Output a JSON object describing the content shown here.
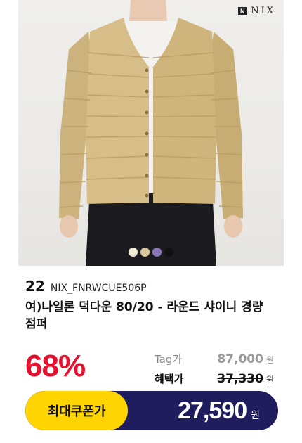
{
  "brand": {
    "logo_text": "NIX"
  },
  "colors": {
    "accent_red": "#e8102f",
    "coupon_yellow": "#ffd400",
    "coupon_navy": "#1f1d5e"
  },
  "swatches": [
    "#f0ead6",
    "#d8c79a",
    "#8a77b8",
    "#111111"
  ],
  "product": {
    "rank": "22",
    "code": "NIX_FNRWCUE506P",
    "title": "여)나일론 덕다운 80/20 - 라운드 샤이니 경량 점퍼",
    "discount": "68%",
    "tag_label": "Tag가",
    "tag_price": "87,000",
    "benefit_label": "혜택가",
    "benefit_price": "37,330",
    "currency": "원",
    "coupon_label": "최대쿠폰가",
    "coupon_price": "27,590"
  }
}
